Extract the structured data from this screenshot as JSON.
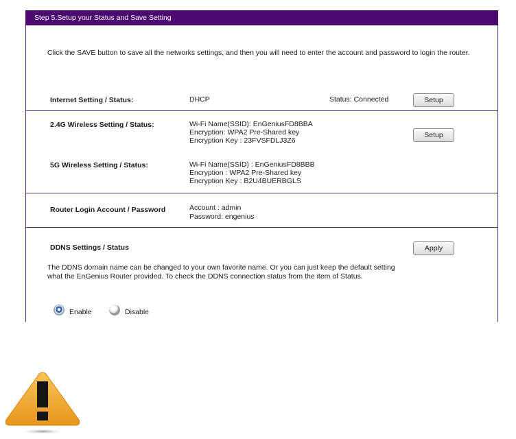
{
  "header": {
    "title": "Step 5.Setup your Status and Save Setting"
  },
  "intro": "Click the SAVE button to save all the networks settings, and then you will need to enter the account and password to login the router.",
  "internet": {
    "label": "Internet Setting / Status:",
    "type": "DHCP",
    "status": "Status: Connected",
    "button": "Setup"
  },
  "wireless24": {
    "label": "2.4G Wireless Setting / Status:",
    "ssid": "Wi-Fi Name(SSID): EnGeniusFD8BBA",
    "encryption": "Encryption: WPA2 Pre-Shared key",
    "key": "Encryption Key : 23FVSFDLJ3Z6",
    "button": "Setup"
  },
  "wireless5": {
    "label": "5G Wireless Setting / Status:",
    "ssid": "Wi-Fi Name(SSID) : EnGeniusFD8BBB",
    "encryption": "Encryption : WPA2 Pre-Shared key",
    "key": "Encryption Key : B2U4BUERBGLS"
  },
  "login": {
    "label": "Router Login Account / Password",
    "account": "Account : admin",
    "password": "Password: engenius"
  },
  "ddns": {
    "label": "DDNS Settings / Status",
    "button": "Apply",
    "description": "The DDNS domain name can be changed to your own favorite name. Or you can just keep the default setting what the EnGenius Router provided. To check the DDNS connection status from the item of Status.",
    "enable_label": "Enable",
    "disable_label": "Disable",
    "selected": "Enable"
  },
  "colors": {
    "header_bg": "#4b0a70",
    "border": "#5a2a7a",
    "warning": "#f5a623"
  },
  "icons": {
    "warning": "warning-icon"
  }
}
